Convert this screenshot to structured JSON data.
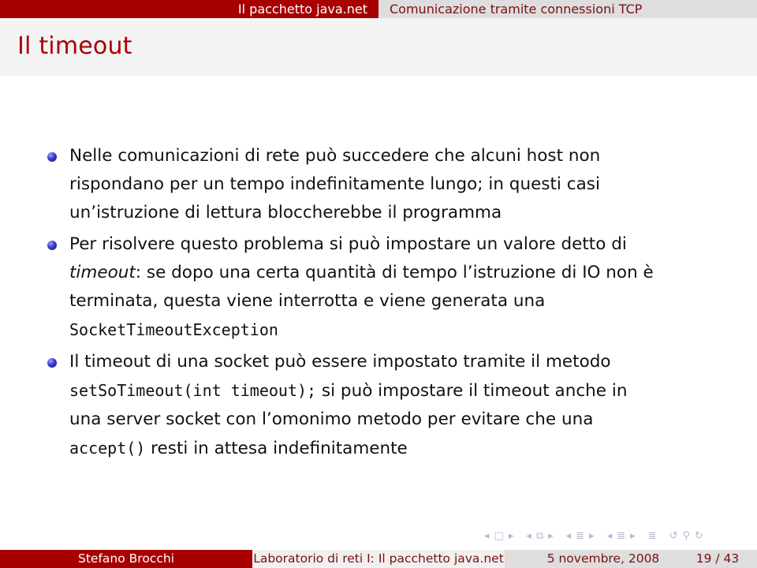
{
  "headline": {
    "section": "Il pacchetto java.net",
    "subsection": "Comunicazione tramite connessioni TCP"
  },
  "frame": {
    "title": "Il timeout"
  },
  "items": [
    {
      "lines": [
        "Nelle comunicazioni di rete può succedere che alcuni host non",
        "rispondano per un tempo indefinitamente lungo; in questi casi",
        "un’istruzione di lettura bloccherebbe il programma"
      ]
    },
    {
      "p1": "Per risolvere questo problema si può impostare un valore detto di",
      "em": "timeout",
      "p2": ": se dopo una certa quantità di tempo l’istruzione di IO non è",
      "p3": "terminata, questa viene interrotta e viene generata una",
      "code": "SocketTimeoutException"
    },
    {
      "p1": "Il timeout di una socket può essere impostato tramite il metodo",
      "code1": "setSoTimeout(int timeout);",
      "p2": " si può impostare il timeout anche in",
      "p3": "una server socket con l’omonimo metodo per evitare che una",
      "code2": "accept()",
      "p4": " resti in attesa indefinitamente"
    }
  ],
  "nav": {
    "icons": [
      "◂",
      "□",
      "▸",
      "◂",
      "⧉",
      "▸",
      "◂",
      "≣",
      "▸",
      "◂",
      "≣",
      "▸",
      "≣",
      "↺",
      "⚲",
      "↻"
    ]
  },
  "footer": {
    "author": "Stefano Brocchi",
    "title": "Laboratorio di reti I: Il pacchetto java.net",
    "date": "5 novembre, 2008",
    "page": "19 / 43"
  },
  "colors": {
    "accent": "#a80000",
    "bullet": "#3a3acc"
  }
}
